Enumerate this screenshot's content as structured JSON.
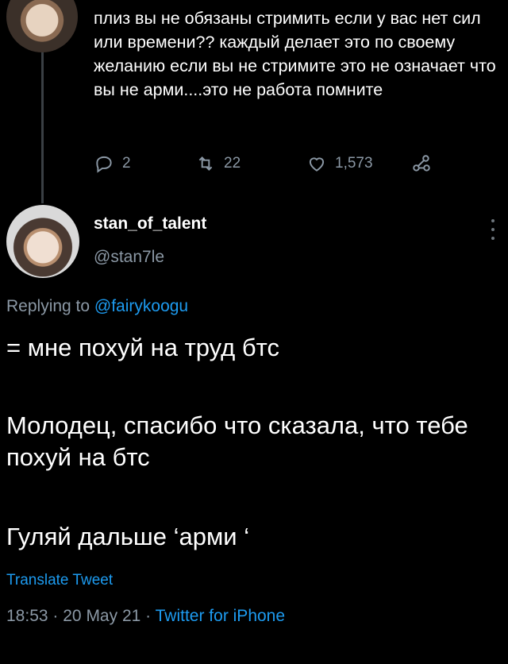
{
  "parent_tweet": {
    "text": "плиз вы не обязаны стримить если у вас нет сил или времени?? каждый делает это по своему желанию если вы не стримите это не означает что вы не арми....это не работа помните",
    "reply_count": "2",
    "retweet_count": "22",
    "like_count": "1,573"
  },
  "tweet": {
    "display_name": "stan_of_talent",
    "handle": "@stan7le",
    "replying_prefix": "Replying to",
    "replying_to": "@fairykoogu",
    "paragraphs": [
      "= мне похуй на труд бтс",
      "Молодец, спасибо что сказала, что тебе похуй на бтс",
      "Гуляй дальше ‘арми ‘"
    ],
    "translate_label": "Translate Tweet",
    "time": "18:53",
    "date": "20 May 21",
    "source": "Twitter for iPhone"
  },
  "icons": [
    "reply-icon",
    "retweet-icon",
    "like-icon",
    "share-icon",
    "more-icon"
  ],
  "colors": {
    "background": "#000000",
    "text": "#ffffff",
    "secondary": "#8b98a5",
    "accent": "#1d9bf0"
  }
}
